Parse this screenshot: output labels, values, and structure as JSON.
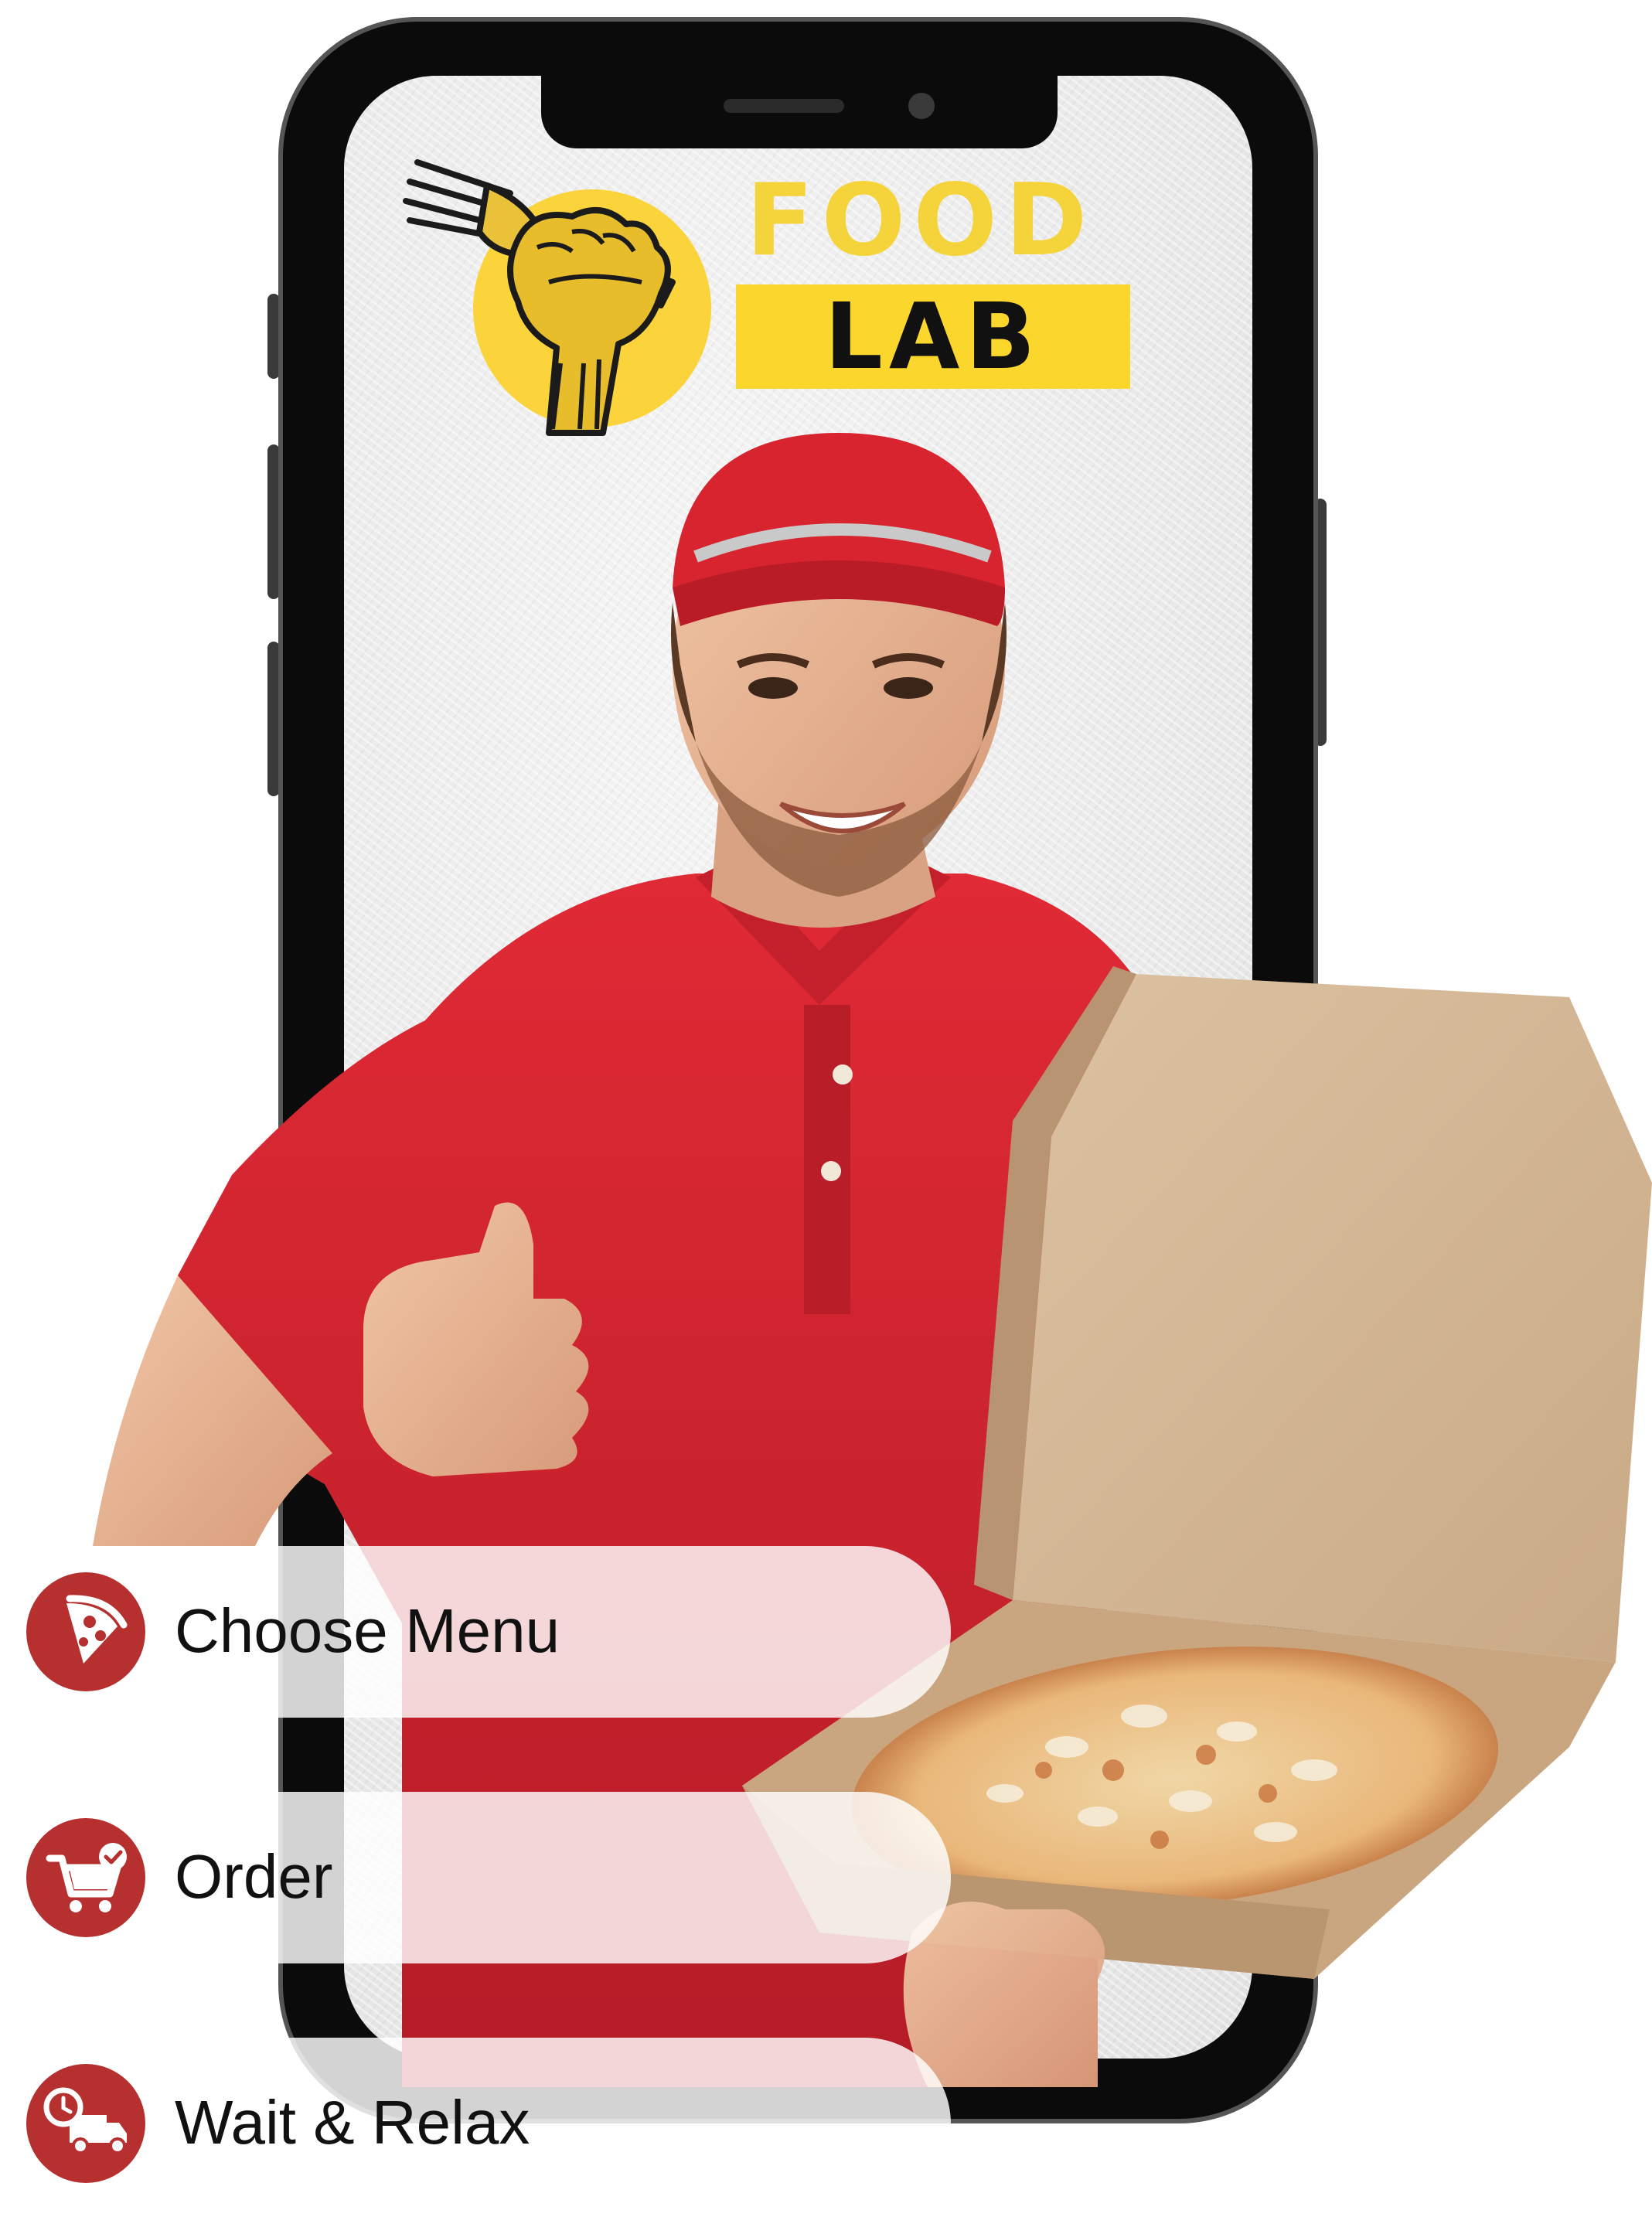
{
  "brand": {
    "word_top": "FOOD",
    "word_bottom": "LAB",
    "logo_icon": "fist-with-fork-icon",
    "colors": {
      "yellow": "#fbd33a",
      "dark": "#111111",
      "accent_red": "#b5302e"
    }
  },
  "steps": [
    {
      "label": "Choose Menu",
      "icon": "pizza-slice-icon"
    },
    {
      "label": "Order",
      "icon": "cart-check-icon"
    },
    {
      "label": "Wait & Relax",
      "icon": "delivery-truck-clock-icon"
    }
  ]
}
